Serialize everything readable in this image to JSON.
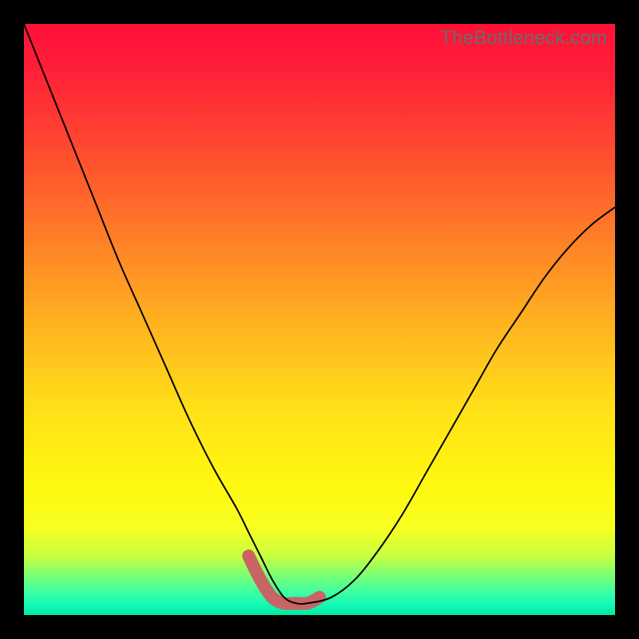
{
  "watermark": "TheBottleneck.com",
  "chart_data": {
    "type": "line",
    "title": "",
    "xlabel": "",
    "ylabel": "",
    "xlim": [
      0,
      100
    ],
    "ylim": [
      0,
      100
    ],
    "series": [
      {
        "name": "thin-black-curve",
        "x": [
          0,
          4,
          8,
          12,
          16,
          20,
          24,
          28,
          32,
          36,
          38,
          40,
          42,
          44,
          46,
          48,
          52,
          56,
          60,
          64,
          68,
          72,
          76,
          80,
          84,
          88,
          92,
          96,
          100
        ],
        "y": [
          100,
          90,
          80,
          70,
          60,
          51,
          42,
          33,
          25,
          18,
          14,
          10,
          6,
          3,
          2,
          2,
          3,
          6,
          11,
          17,
          24,
          31,
          38,
          45,
          51,
          57,
          62,
          66,
          69
        ]
      },
      {
        "name": "thick-salmon-bottom",
        "x": [
          38,
          40,
          42,
          44,
          46,
          48,
          50
        ],
        "y": [
          10,
          6,
          3,
          2,
          2,
          2,
          3
        ]
      }
    ],
    "gradient_stops": [
      {
        "offset": 0.0,
        "color": "#ff1038"
      },
      {
        "offset": 0.08,
        "color": "#ff2038"
      },
      {
        "offset": 0.2,
        "color": "#ff4630"
      },
      {
        "offset": 0.35,
        "color": "#ff7a28"
      },
      {
        "offset": 0.5,
        "color": "#ffb020"
      },
      {
        "offset": 0.65,
        "color": "#ffe018"
      },
      {
        "offset": 0.78,
        "color": "#fff810"
      },
      {
        "offset": 0.85,
        "color": "#f8ff20"
      },
      {
        "offset": 0.9,
        "color": "#c8ff40"
      },
      {
        "offset": 0.93,
        "color": "#80ff70"
      },
      {
        "offset": 0.96,
        "color": "#40ffa0"
      },
      {
        "offset": 0.985,
        "color": "#10f8b8"
      },
      {
        "offset": 1.0,
        "color": "#00e8a0"
      }
    ]
  }
}
